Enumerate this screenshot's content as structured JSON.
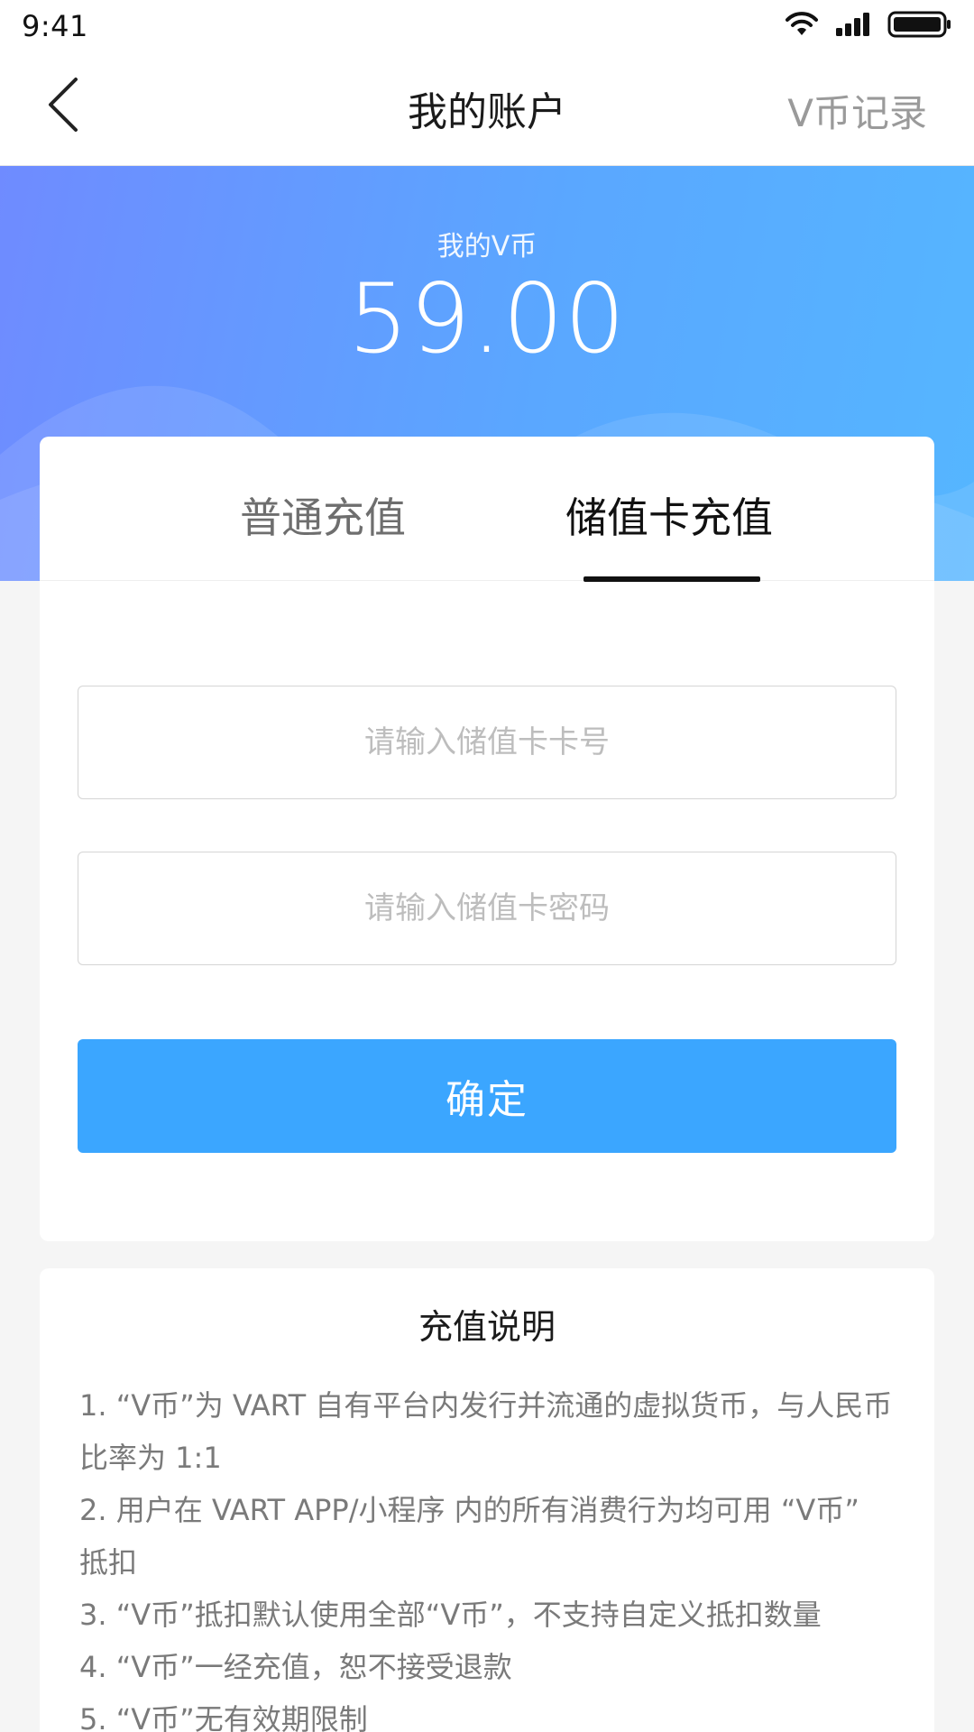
{
  "status_bar": {
    "time": "9:41",
    "icons": [
      "wifi-icon",
      "signal-icon",
      "battery-icon"
    ]
  },
  "nav": {
    "back_icon": "chevron-left-icon",
    "title": "我的账户",
    "right_action": "V币记录"
  },
  "balance": {
    "label": "我的V币",
    "amount": "59.00"
  },
  "tabs": [
    {
      "label": "普通充值",
      "active": false
    },
    {
      "label": "储值卡充值",
      "active": true
    }
  ],
  "form": {
    "card_number_placeholder": "请输入储值卡卡号",
    "card_password_placeholder": "请输入储值卡密码",
    "card_number_value": "",
    "card_password_value": "",
    "confirm_label": "确定"
  },
  "info": {
    "title": "充值说明",
    "items": [
      "1. “V币”为 VART 自有平台内发行并流通的虚拟货币，与人民币比率为 1:1",
      "2. 用户在 VART APP/小程序 内的所有消费行为均可用 “V币” 抵扣",
      "3. “V币”抵扣默认使用全部“V币”，不支持自定义抵扣数量",
      "4. “V币”一经充值，恕不接受退款",
      "5. “V币”无有效期限制"
    ]
  },
  "colors": {
    "accent": "#3ba6ff",
    "header_gradient_start": "#6f8bff",
    "header_gradient_end": "#55b6ff",
    "muted_text": "#7a7a7a"
  }
}
